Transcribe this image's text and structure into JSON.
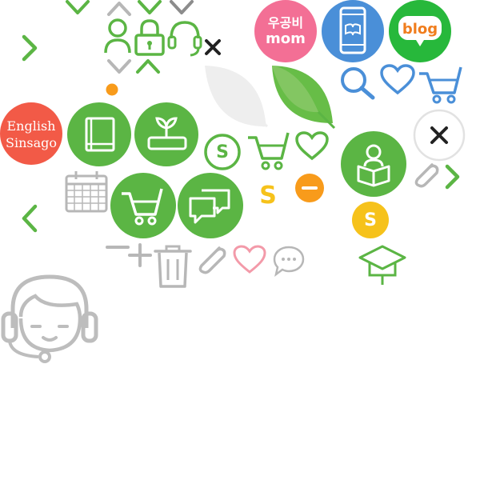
{
  "badges": {
    "english_line1": "English",
    "english_line2": "Sinsago",
    "woogongbi": "우공비",
    "mom": "mom",
    "blog": "blog",
    "coin": "S"
  },
  "colors": {
    "green": "#5bb544",
    "green_light": "#8cc96b",
    "grey": "#b7b7b7",
    "grey_dark": "#8c8c8c",
    "pink": "#f36f95",
    "blue": "#4a8fd8",
    "blog_green": "#27b83b",
    "blog_orange": "#f07d1d",
    "red_badge": "#f25a47",
    "yellow": "#f6c21b",
    "orange": "#f89b1b"
  },
  "icons": [
    "chevron-down-icon",
    "chevron-up-icon",
    "chevron-right-icon",
    "chevron-left-icon",
    "user-icon",
    "lock-icon",
    "headset-icon",
    "close-icon",
    "leaf-icon",
    "search-icon",
    "heart-icon",
    "cart-icon",
    "book-icon",
    "sprout-icon",
    "coin-icon",
    "minus-icon",
    "plus-icon",
    "reader-icon",
    "paperclip-icon",
    "calendar-icon",
    "chat-icon",
    "trash-icon",
    "speech-bubble-icon",
    "graduation-cap-icon",
    "counselor-icon",
    "dot-icon"
  ]
}
